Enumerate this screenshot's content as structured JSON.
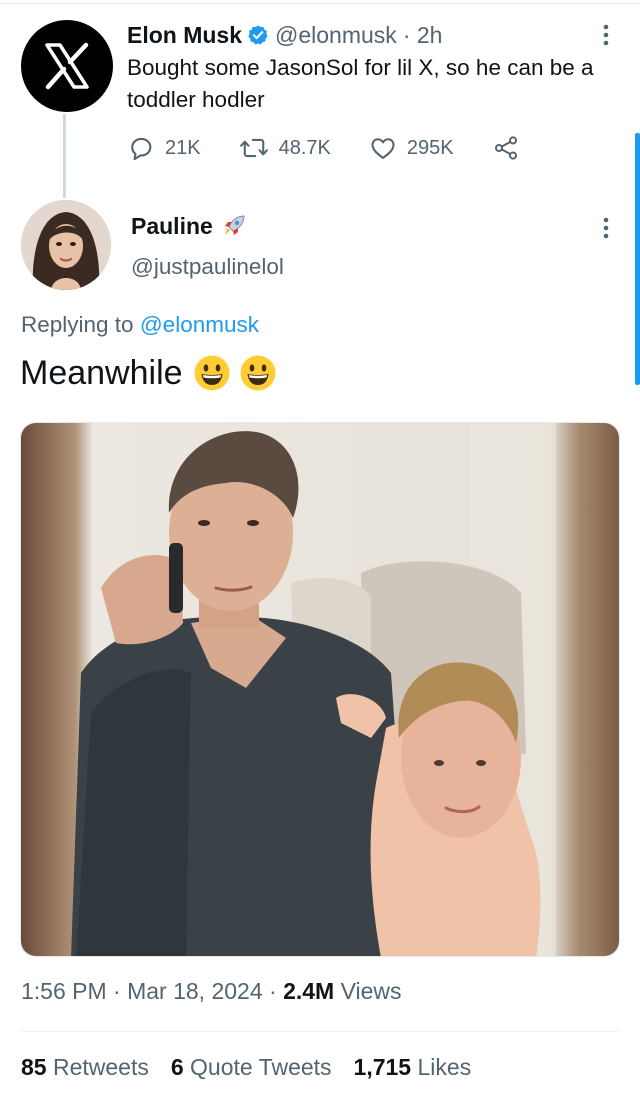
{
  "tweet": {
    "author_name": "Elon Musk",
    "handle": "@elonmusk",
    "time": "· 2h",
    "text": "Bought some JasonSol for lil X, so he can be a toddler hodler",
    "actions": {
      "replies": "21K",
      "retweets": "48.7K",
      "likes": "295K"
    },
    "icons": [
      "x-logo-icon",
      "verified-badge-icon",
      "reply-icon",
      "retweet-icon",
      "like-icon",
      "share-icon",
      "more-icon"
    ]
  },
  "reply": {
    "author_name": "Pauline",
    "name_emoji_icon": "rocket-icon",
    "handle": "@justpaulinelol",
    "replying_label": "Replying to",
    "replying_to": "@elonmusk",
    "text": "Meanwhile",
    "text_emojis": [
      "grinning-face-icon",
      "grinning-face-icon"
    ],
    "timestamp": "1:56 PM · Mar 18, 2024 ·",
    "views_count": "2.4M",
    "views_label": "Views",
    "retweets_count": "85",
    "retweets_label": "Retweets",
    "quotes_count": "6",
    "quotes_label": "Quote Tweets",
    "likes_count": "1,715",
    "likes_label": "Likes"
  },
  "colors": {
    "accent": "#1d9bf0",
    "muted": "#536471",
    "text": "#0f1419"
  }
}
